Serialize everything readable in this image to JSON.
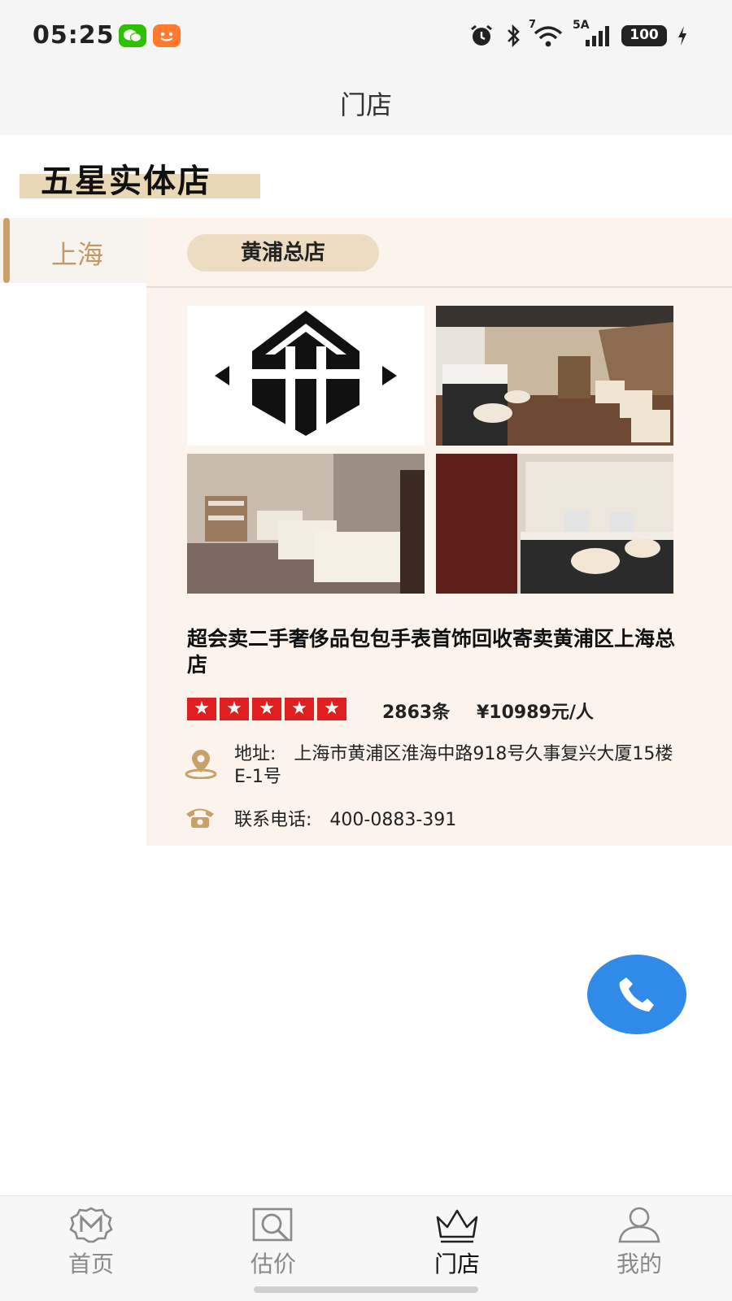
{
  "status_bar": {
    "time": "05:25",
    "icons": [
      "wechat-icon",
      "taobao-icon",
      "alarm-icon",
      "bluetooth-icon",
      "wifi-icon",
      "cellular-icon"
    ],
    "wifi_label": "7",
    "network_label": "5A",
    "battery_level": "100"
  },
  "header": {
    "title": "门店"
  },
  "section": {
    "heading": "五星实体店"
  },
  "sidebar": {
    "cities": [
      {
        "label": "上海",
        "selected": true
      }
    ]
  },
  "branches": [
    {
      "label": "黄浦总店",
      "selected": true
    }
  ],
  "store": {
    "name": "超会卖二手奢侈品包包手表首饰回收寄卖黄浦区上海总店",
    "rating_stars": 5,
    "review_count": "2863条",
    "avg_price": "¥10989元/人",
    "address_label": "地址:",
    "address": "上海市黄浦区淮海中路918号久事复兴大厦15楼E-1号",
    "phone_label": "联系电话:",
    "phone": "400-0883-391",
    "accent_color": "#e02020"
  },
  "tab_bar": {
    "tabs": [
      {
        "label": "首页",
        "icon": "home-logo-icon",
        "active": false
      },
      {
        "label": "估价",
        "icon": "estimate-icon",
        "active": false
      },
      {
        "label": "门店",
        "icon": "crown-icon",
        "active": true
      },
      {
        "label": "我的",
        "icon": "user-icon",
        "active": false
      }
    ]
  },
  "colors": {
    "gold": "#c8a06a",
    "pill": "#ecdcc2",
    "panel": "#fcf4ec",
    "call": "#2f8ae8"
  }
}
